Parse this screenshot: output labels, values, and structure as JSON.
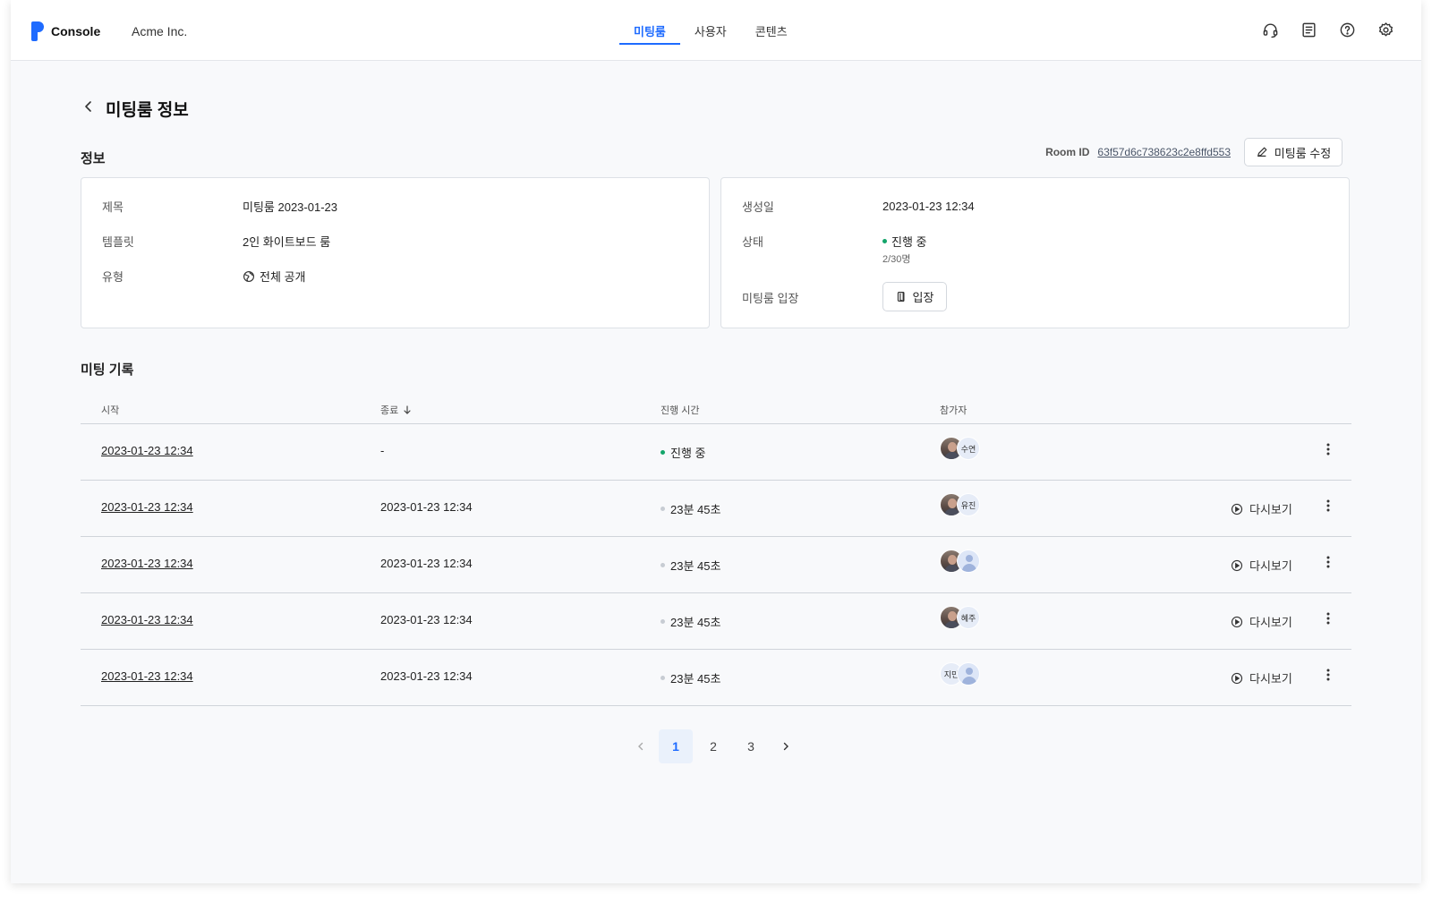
{
  "header": {
    "app_name": "Console",
    "org_name": "Acme Inc.",
    "nav": [
      "미팅룸",
      "사용자",
      "콘텐츠"
    ],
    "nav_active": 0,
    "icons": [
      "headset-icon",
      "document-icon",
      "help-icon",
      "settings-icon"
    ]
  },
  "page": {
    "title": "미팅룸 정보",
    "info_section": "정보",
    "room_id_label": "Room ID",
    "room_id": "63f57d6c738623c2e8ffd553",
    "edit_label": "미팅룸 수정"
  },
  "info_left": {
    "title_label": "제목",
    "title_value": "미팅룸 2023-01-23",
    "template_label": "템플릿",
    "template_value": "2인 화이트보드 룸",
    "type_label": "유형",
    "type_value": "전체 공개"
  },
  "info_right": {
    "created_label": "생성일",
    "created_value": "2023-01-23 12:34",
    "status_label": "상태",
    "status_value": "진행 중",
    "status_sub": "2/30명",
    "enter_label": "미팅룸 입장",
    "enter_button": "입장"
  },
  "history": {
    "section": "미팅 기록",
    "columns": [
      "시작",
      "종료",
      "진행 시간",
      "참가자"
    ],
    "replay_label": "다시보기",
    "rows": [
      {
        "start": "2023-01-23 12:34",
        "end": "-",
        "duration": "진행 중",
        "live": true,
        "avatars": [
          "photo",
          "수연"
        ],
        "replay": false
      },
      {
        "start": "2023-01-23 12:34",
        "end": "2023-01-23 12:34",
        "duration": "23분 45초",
        "live": false,
        "avatars": [
          "photo",
          "유진"
        ],
        "replay": true
      },
      {
        "start": "2023-01-23 12:34",
        "end": "2023-01-23 12:34",
        "duration": "23분 45초",
        "live": false,
        "avatars": [
          "photo",
          "person"
        ],
        "replay": true
      },
      {
        "start": "2023-01-23 12:34",
        "end": "2023-01-23 12:34",
        "duration": "23분 45초",
        "live": false,
        "avatars": [
          "photo",
          "혜주"
        ],
        "replay": true
      },
      {
        "start": "2023-01-23 12:34",
        "end": "2023-01-23 12:34",
        "duration": "23분 45초",
        "live": false,
        "avatars": [
          "지민",
          "person"
        ],
        "replay": true
      }
    ]
  },
  "pagination": {
    "pages": [
      "1",
      "2",
      "3"
    ],
    "current": "1"
  },
  "colors": {
    "accent": "#1e6bff",
    "live": "#13a56a"
  }
}
